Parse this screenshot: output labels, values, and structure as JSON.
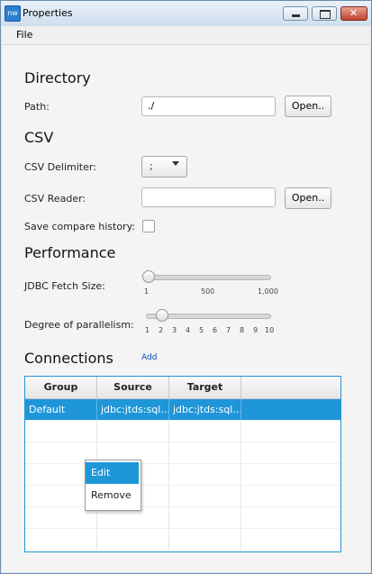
{
  "window": {
    "title": "Properties",
    "icon_text": "nw"
  },
  "menubar": {
    "file": "File"
  },
  "directory": {
    "section": "Directory",
    "path_label": "Path:",
    "path_value": "./",
    "open_label": "Open.."
  },
  "csv": {
    "section": "CSV",
    "delimiter_label": "CSV Delimiter:",
    "delimiter_value": ";",
    "reader_label": "CSV Reader:",
    "reader_value": "",
    "open_label": "Open..",
    "save_history_label": "Save compare history:",
    "save_history_checked": false
  },
  "performance": {
    "section": "Performance",
    "fetch_label": "JDBC Fetch Size:",
    "fetch_ticks": [
      "1",
      "500",
      "1,000"
    ],
    "fetch_value": 1,
    "parallel_label": "Degree of parallelism:",
    "parallel_ticks": [
      "1",
      "2",
      "3",
      "4",
      "5",
      "6",
      "7",
      "8",
      "9",
      "10"
    ],
    "parallel_value": 2
  },
  "connections": {
    "section": "Connections",
    "add_label": "Add",
    "columns": [
      "Group",
      "Source",
      "Target"
    ],
    "rows": [
      {
        "group": "Default",
        "source": "jdbc:jtds:sql...",
        "target": "jdbc:jtds:sql..."
      }
    ]
  },
  "context_menu": {
    "items": [
      "Edit",
      "Remove"
    ]
  },
  "colors": {
    "accent": "#1f96d8",
    "titlebar": "#dbe7f3"
  }
}
